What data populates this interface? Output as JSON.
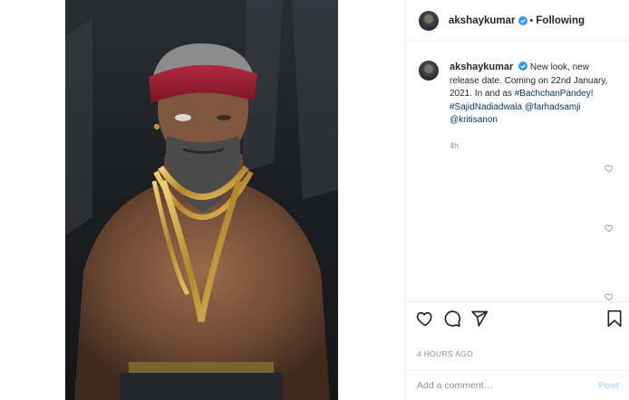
{
  "header": {
    "username": "akshaykumar",
    "separator": "•",
    "follow_status": "Following"
  },
  "caption": {
    "username": "akshaykumar",
    "text_1": "New look, new release date. Coming on 22nd January, 2021. In and as ",
    "hashtag_1": "#BachchanPandey",
    "text_2": "! ",
    "hashtag_2": "#SajidNadiadwala",
    "text_3": " ",
    "mention_1": "@farhadsamji",
    "text_4": " ",
    "mention_2": "@kritisanon",
    "time": "4h"
  },
  "actions": {
    "icons": [
      "heart-icon",
      "comment-icon",
      "share-icon",
      "bookmark-icon"
    ],
    "timestamp": "4 HOURS AGO"
  },
  "comment_box": {
    "placeholder": "Add a comment…",
    "post_label": "Post"
  },
  "colors": {
    "link": "#00376b",
    "muted": "#8e8e8e",
    "verified": "#3897f0",
    "post_disabled": "#b2dffc"
  }
}
